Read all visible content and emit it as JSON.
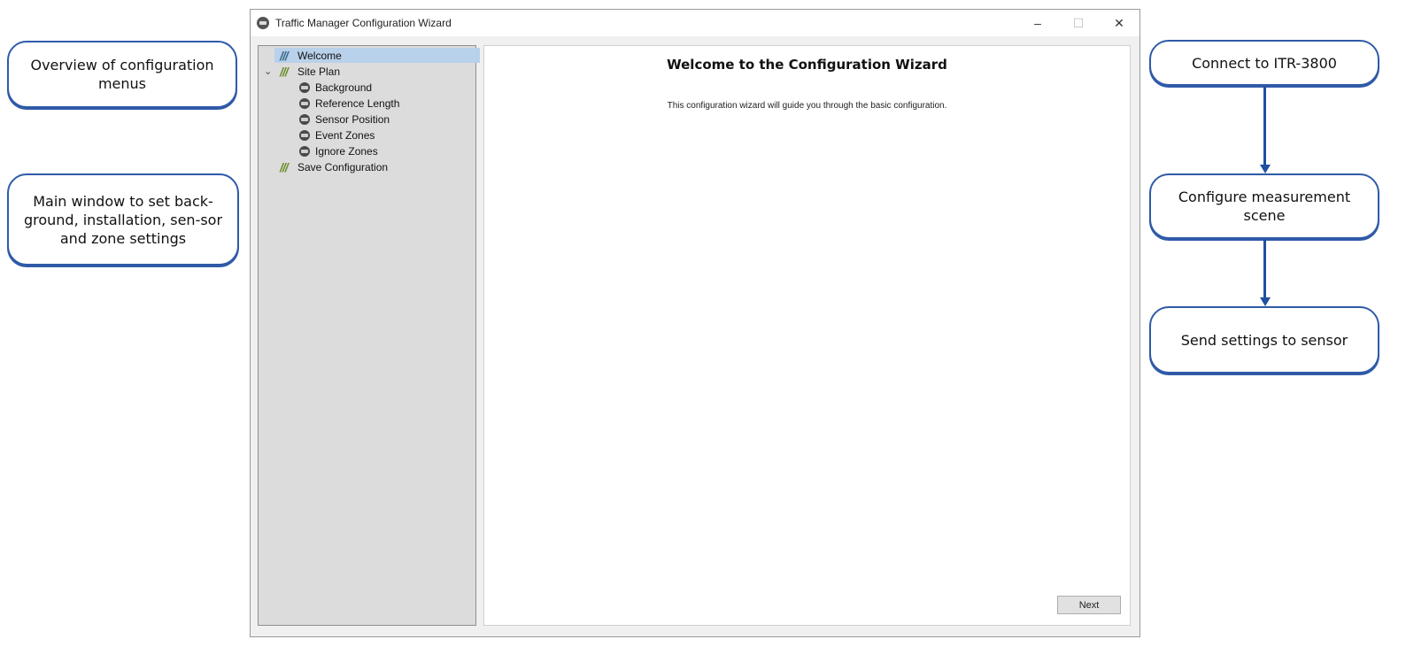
{
  "window": {
    "title": "Traffic Manager Configuration Wizard",
    "controls": {
      "minimize": "–",
      "maximize": "☐",
      "close": "✕"
    }
  },
  "tree": {
    "items": [
      {
        "label": "Welcome",
        "icon": "stripes-icon",
        "selected": true
      },
      {
        "label": "Site Plan",
        "icon": "stripes-icon",
        "expanded": true
      },
      {
        "label": "Background",
        "icon": "sensor-icon"
      },
      {
        "label": "Reference Length",
        "icon": "sensor-icon"
      },
      {
        "label": "Sensor Position",
        "icon": "sensor-icon"
      },
      {
        "label": "Event Zones",
        "icon": "sensor-icon"
      },
      {
        "label": "Ignore Zones",
        "icon": "sensor-icon"
      },
      {
        "label": "Save Configuration",
        "icon": "stripes-icon"
      }
    ]
  },
  "content": {
    "heading": "Welcome to the Configuration Wizard",
    "description": "This configuration wizard will guide you through the basic configuration.",
    "next_label": "Next"
  },
  "callouts": {
    "left_top": "Overview of configuration menus",
    "left_main": "Main window to set back-ground, installation, sen-sor and zone settings",
    "right_1": "Connect to ITR-3800",
    "right_2": "Configure measurement scene",
    "right_3": "Send settings to sensor"
  },
  "colors": {
    "callout_border": "#2f5aa8",
    "arrow": "#1f4fa0",
    "selection": "#b9d1ea"
  }
}
